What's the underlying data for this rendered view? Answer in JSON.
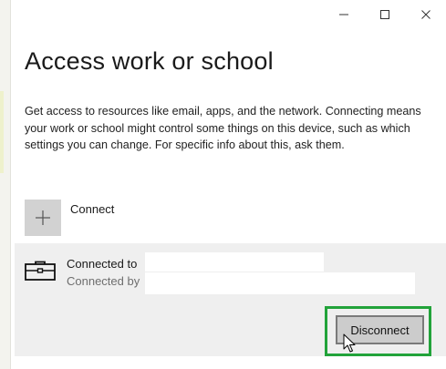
{
  "window": {
    "controls": [
      {
        "name": "minimize-button",
        "icon": "minimize-icon"
      },
      {
        "name": "maximize-button",
        "icon": "maximize-icon"
      },
      {
        "name": "close-button",
        "icon": "close-icon"
      }
    ]
  },
  "page": {
    "title": "Access work or school",
    "description": "Get access to resources like email, apps, and the network. Connecting means your work or school might control some things on this device, such as which settings you can change. For specific info about this, ask them."
  },
  "connect": {
    "label": "Connect",
    "icon": "plus-icon"
  },
  "account": {
    "icon": "briefcase-icon",
    "connected_to_label": "Connected to",
    "connected_by_label": "Connected by",
    "disconnect_label": "Disconnect"
  },
  "colors": {
    "highlight": "#22a33a",
    "panel": "#efefef",
    "tile": "#d2d2d2"
  }
}
